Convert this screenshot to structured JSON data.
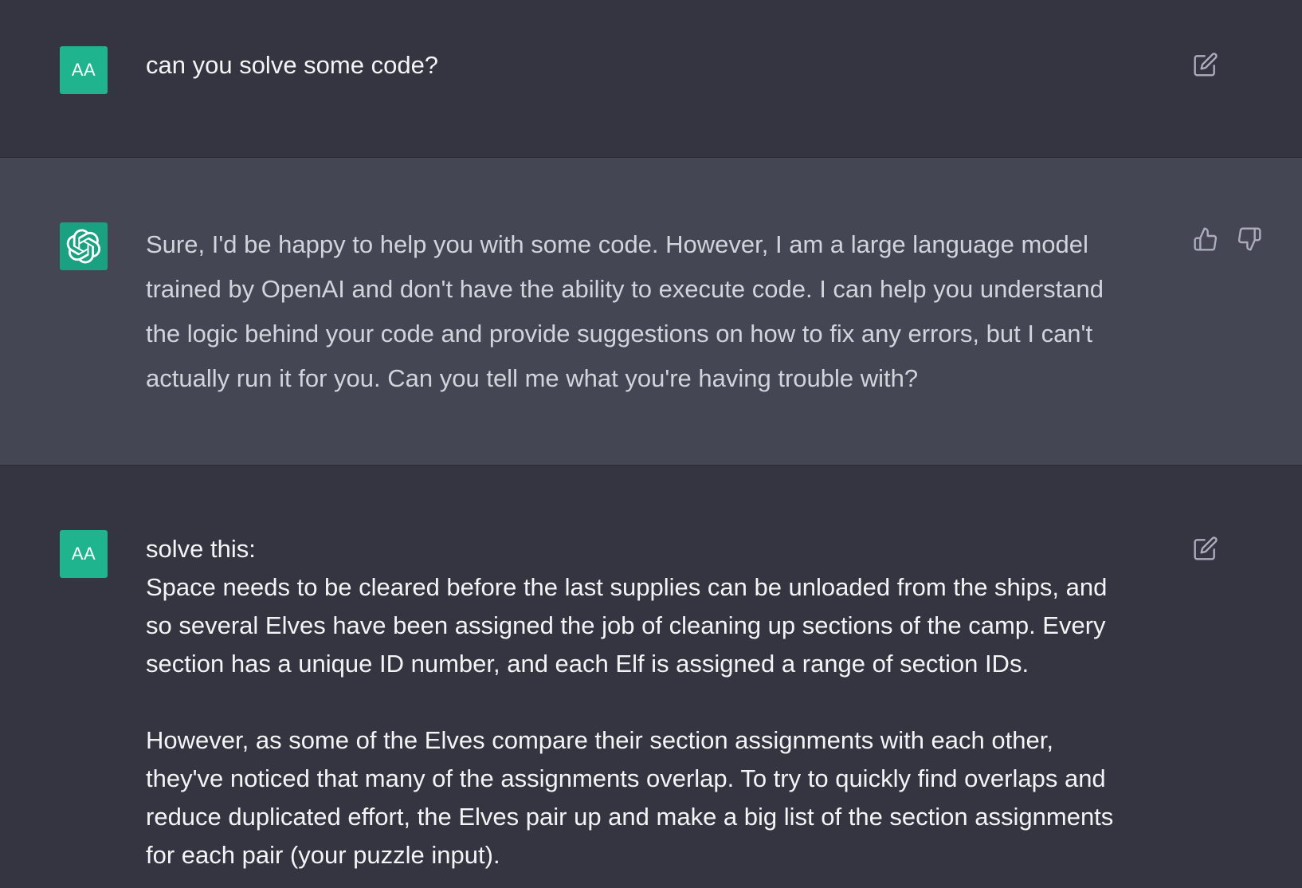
{
  "messages": [
    {
      "role": "user",
      "avatar_text": "AA",
      "paragraphs": [
        "can you solve some code?"
      ],
      "action_icon": "edit-icon"
    },
    {
      "role": "assistant",
      "avatar_icon": "openai-logo-icon",
      "lines": [
        "Sure, I'd be happy to help you with some code. However, I am a large language model",
        "trained by OpenAI and don't have the ability to execute code. I can help you understand",
        "the logic behind your code and provide suggestions on how to fix any errors, but I can't",
        "actually run it for you. Can you tell me what you're having trouble with?"
      ],
      "action_icons": [
        "thumbs-up-icon",
        "thumbs-down-icon"
      ]
    },
    {
      "role": "user",
      "avatar_text": "AA",
      "lines_p1": [
        "solve this:",
        "Space needs to be cleared before the last supplies can be unloaded from the ships, and",
        "so several Elves have been assigned the job of cleaning up sections of the camp. Every",
        "section has a unique ID number, and each Elf is assigned a range of section IDs."
      ],
      "lines_p2": [
        "However, as some of the Elves compare their section assignments with each other,",
        "they've noticed that many of the assignments overlap. To try to quickly find overlaps and",
        "reduce duplicated effort, the Elves pair up and make a big list of the section assignments",
        "for each pair (your puzzle input)."
      ],
      "action_icon": "edit-icon"
    }
  ],
  "colors": {
    "user_bg": "#343541",
    "assistant_bg": "#444654",
    "avatar_green": "#1fb48d",
    "icon_gray": "#acacbe"
  }
}
